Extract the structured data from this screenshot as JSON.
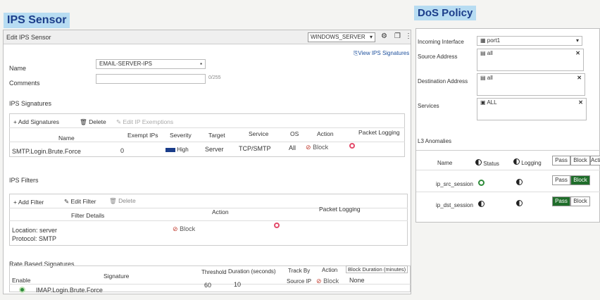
{
  "ips": {
    "tag": "IPS Sensor",
    "profile_select": "WINDOWS_SERVER",
    "edit_title": "Edit IPS Sensor",
    "view_link": "View IPS Signatures",
    "name_label": "Name",
    "name_value": "EMAIL-SERVER-IPS",
    "comments_label": "Comments",
    "comments_counter": "0/255",
    "signatures": {
      "section": "IPS Signatures",
      "add": "Add Signatures",
      "delete": "Delete",
      "edit_ex": "Edit IP Exemptions",
      "cols": [
        "Name",
        "Exempt IPs",
        "Severity",
        "Target",
        "Service",
        "OS",
        "Action",
        "Packet Logging"
      ],
      "row": {
        "name": "SMTP.Login.Brute.Force",
        "exempt": "0",
        "severity": "High",
        "target": "Server",
        "service": "TCP/SMTP",
        "os": "All",
        "action": "Block"
      }
    },
    "filters": {
      "section": "IPS Filters",
      "add": "Add Filter",
      "edit": "Edit Filter",
      "delete": "Delete",
      "cols": [
        "Filter Details",
        "Action",
        "Packet Logging"
      ],
      "row": {
        "location": "Location: server",
        "protocol": "Protocol: SMTP",
        "action": "Block"
      }
    },
    "rate": {
      "section": "Rate Based Signatures",
      "cols": [
        "Enable",
        "Signature",
        "Threshold",
        "Duration (seconds)",
        "Track By",
        "Action",
        "Block Duration (minutes)"
      ],
      "row": {
        "signature": "IMAP.Login.Brute.Force",
        "threshold": "60",
        "duration": "10",
        "track": "Source IP",
        "action": "Block",
        "block_duration": "None"
      }
    }
  },
  "dos": {
    "tag": "DoS Policy",
    "incoming_label": "Incoming Interface",
    "incoming_value": "port1",
    "src_label": "Source Address",
    "src_value": "all",
    "dst_label": "Destination Address",
    "dst_value": "all",
    "svc_label": "Services",
    "svc_value": "ALL",
    "l3": "L3 Anomalies",
    "cols": {
      "name": "Name",
      "status": "Status",
      "logging": "Logging",
      "pass": "Pass",
      "block": "Block",
      "action": "Action"
    },
    "rows": [
      {
        "name": "ip_src_session",
        "pass": "Pass",
        "block": "Block",
        "active": "block"
      },
      {
        "name": "ip_dst_session",
        "pass": "Pass",
        "block": "Block",
        "active": "pass"
      }
    ]
  }
}
